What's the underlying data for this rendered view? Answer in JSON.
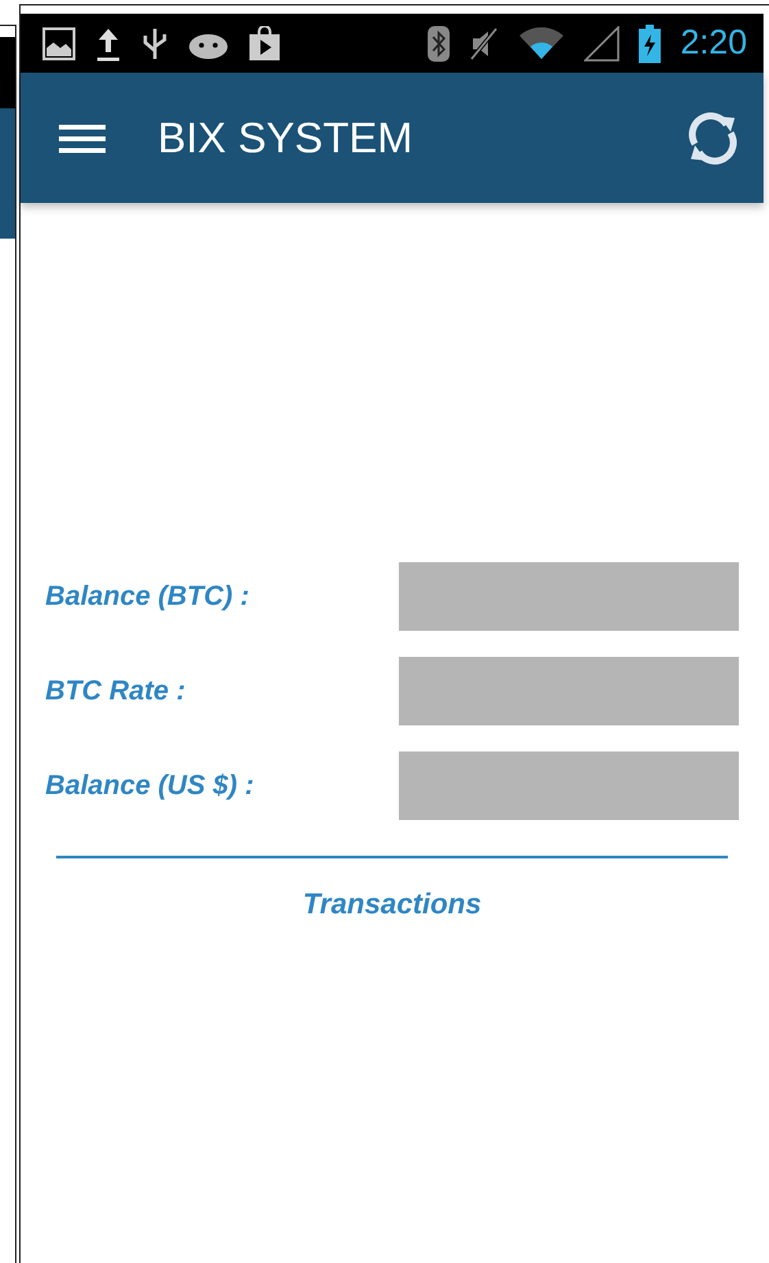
{
  "status_bar": {
    "time": "2:20"
  },
  "app_bar": {
    "title": "BIX SYSTEM"
  },
  "fields": [
    {
      "label": "Balance (BTC) :"
    },
    {
      "label": "BTC Rate :"
    },
    {
      "label": "Balance (US $) :"
    }
  ],
  "section_title": "Transactions"
}
